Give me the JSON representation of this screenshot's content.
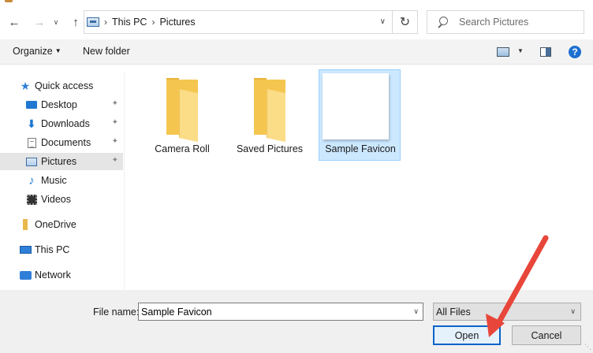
{
  "address": {
    "crumbs": [
      "This PC",
      "Pictures"
    ]
  },
  "search": {
    "placeholder": "Search Pictures"
  },
  "toolbar": {
    "organize_label": "Organize",
    "new_folder_label": "New folder",
    "help_label": "?"
  },
  "sidebar": {
    "items": [
      {
        "label": "Quick access",
        "icon": "star-icon"
      },
      {
        "label": "Desktop",
        "icon": "desktop-icon"
      },
      {
        "label": "Downloads",
        "icon": "download-icon"
      },
      {
        "label": "Documents",
        "icon": "documents-icon"
      },
      {
        "label": "Pictures",
        "icon": "pictures-icon",
        "selected": true
      },
      {
        "label": "Music",
        "icon": "music-icon"
      },
      {
        "label": "Videos",
        "icon": "videos-icon"
      },
      {
        "label": "OneDrive",
        "icon": "onedrive-icon"
      },
      {
        "label": "This PC",
        "icon": "this-pc-icon"
      },
      {
        "label": "Network",
        "icon": "network-icon"
      }
    ]
  },
  "files": [
    {
      "label": "Camera Roll",
      "type": "folder"
    },
    {
      "label": "Saved Pictures",
      "type": "folder"
    },
    {
      "label": "Sample Favicon",
      "type": "image",
      "selected": true
    }
  ],
  "footer": {
    "file_name_label": "File name:",
    "file_name_value": "Sample Favicon",
    "filter_value": "All Files",
    "open_label": "Open",
    "cancel_label": "Cancel"
  },
  "colors": {
    "accent": "#0a64c9",
    "selection": "#cce8ff",
    "annotation_arrow": "#e8463a"
  }
}
